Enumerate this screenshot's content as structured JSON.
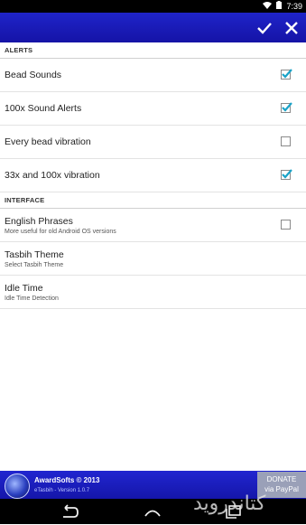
{
  "status_bar": {
    "time": "7:39",
    "wifi_icon": "wifi-icon",
    "battery_icon": "battery-icon"
  },
  "action_bar": {
    "confirm_icon": "check-icon",
    "close_icon": "close-icon"
  },
  "sections": {
    "alerts": {
      "header": "ALERTS",
      "items": [
        {
          "label": "Bead Sounds",
          "checked": true
        },
        {
          "label": "100x Sound Alerts",
          "checked": true
        },
        {
          "label": "Every bead vibration",
          "checked": false
        },
        {
          "label": "33x and 100x vibration",
          "checked": true
        }
      ]
    },
    "interface": {
      "header": "INTERFACE",
      "items": [
        {
          "label": "English Phrases",
          "summary": "More useful for old Android OS versions",
          "checked": false
        },
        {
          "label": "Tasbih Theme",
          "summary": "Select Tasbih Theme"
        },
        {
          "label": "Idle Time",
          "summary": "Idle Time Detection"
        }
      ]
    }
  },
  "footer": {
    "brand": "AwardSofts © 2013",
    "version": "eTasbih - Version 1.0.7",
    "donate_line1": "DONATE",
    "donate_line2": "via PayPal",
    "watermark": "کتاندروید"
  },
  "nav_bar": {
    "back_icon": "back-icon",
    "home_icon": "home-icon",
    "recents_icon": "recents-icon"
  },
  "colors": {
    "action_bar": "#1f24c9",
    "checkbox_check": "#1aa3c8"
  }
}
